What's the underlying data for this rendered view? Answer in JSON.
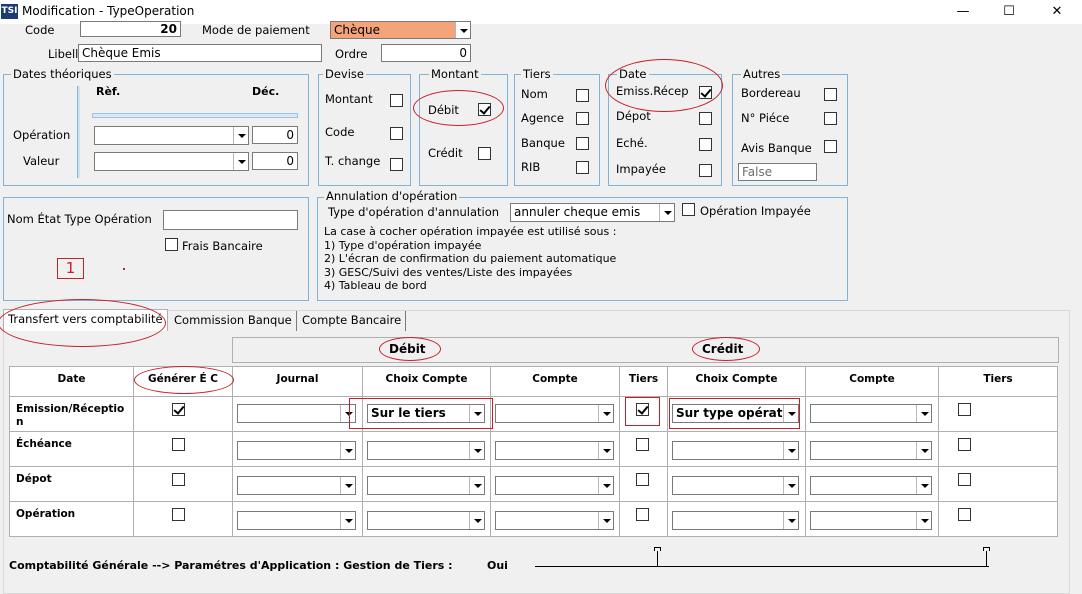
{
  "window": {
    "icon_text": "TSI",
    "title": "Modification - TypeOperation",
    "minimize": "—",
    "maximize": "☐",
    "close": "✕"
  },
  "top": {
    "code_label": "Code",
    "code_value": "20",
    "mode_label": "Mode de paiement",
    "mode_value": "Chèque",
    "libelle_label": "Libellé",
    "libelle_value": "Chèque Emis",
    "ordre_label": "Ordre",
    "ordre_value": "0"
  },
  "dates": {
    "title": "Dates théoriques",
    "ref": "Rèf.",
    "dec": "Déc.",
    "operation": "Opération",
    "valeur": "Valeur",
    "operation_dec": "0",
    "valeur_dec": "0"
  },
  "devise": {
    "title": "Devise",
    "montant": "Montant",
    "code": "Code",
    "change": "T. change"
  },
  "montant": {
    "title": "Montant",
    "debit": "Débit",
    "credit": "Crédit",
    "debit_checked": true,
    "credit_checked": false
  },
  "tiers": {
    "title": "Tiers",
    "nom": "Nom",
    "agence": "Agence",
    "banque": "Banque",
    "rib": "RIB"
  },
  "date_grp": {
    "title": "Date",
    "emiss": "Emiss.Récep",
    "depot": "Dépot",
    "eche": "Eché.",
    "impayee": "Impayée",
    "emiss_checked": true
  },
  "autres": {
    "title": "Autres",
    "bordereau": "Bordereau",
    "npiece": "N° Piéce",
    "avis": "Avis Banque",
    "false_value": "False"
  },
  "nom_etat": {
    "label": "Nom État Type Opération",
    "value": "",
    "frais": "Frais Bancaire",
    "marker": "1"
  },
  "annulation": {
    "title": "Annulation d'opération",
    "type_label": "Type d'opération d'annulation",
    "type_value": "annuler cheque emis",
    "impayee_label": "Opération Impayée",
    "info_line0": "La case à cocher opération impayée est utilisé sous :",
    "info_line1": "1) Type d'opération impayée",
    "info_line2": "2) L'écran de confirmation du paiement automatique",
    "info_line3": "3) GESC/Suivi des ventes/Liste des impayées",
    "info_line4": "4) Tableau de bord"
  },
  "tabs": [
    {
      "label": "Transfert vers comptabilité"
    },
    {
      "label": "Commission Banque"
    },
    {
      "label": "Compte Bancaire"
    }
  ],
  "grid": {
    "debit_title": "Débit",
    "credit_title": "Crédit",
    "headers": {
      "date": "Date",
      "generer": "Générer É C",
      "journal": "Journal",
      "choix1": "Choix Compte",
      "compte1": "Compte",
      "tiers1": "Tiers",
      "choix2": "Choix Compte",
      "compte2": "Compte",
      "tiers2": "Tiers"
    },
    "rows": [
      {
        "label": "Emission/Réceptio n",
        "generer": true,
        "choix1": "Sur le tiers",
        "tiers1": true,
        "choix2": "Sur type opération",
        "tiers2": false
      },
      {
        "label": "Échéance",
        "generer": false,
        "choix1": "",
        "tiers1": false,
        "choix2": "",
        "tiers2": false
      },
      {
        "label": "Dépot",
        "generer": false,
        "choix1": "",
        "tiers1": false,
        "choix2": "",
        "tiers2": false
      },
      {
        "label": "Opération",
        "generer": false,
        "choix1": "",
        "tiers1": false,
        "choix2": "",
        "tiers2": false
      }
    ]
  },
  "footer": {
    "text": "Comptabilité Générale --> Paramétres d'Application : Gestion de Tiers :",
    "value": "Oui"
  }
}
